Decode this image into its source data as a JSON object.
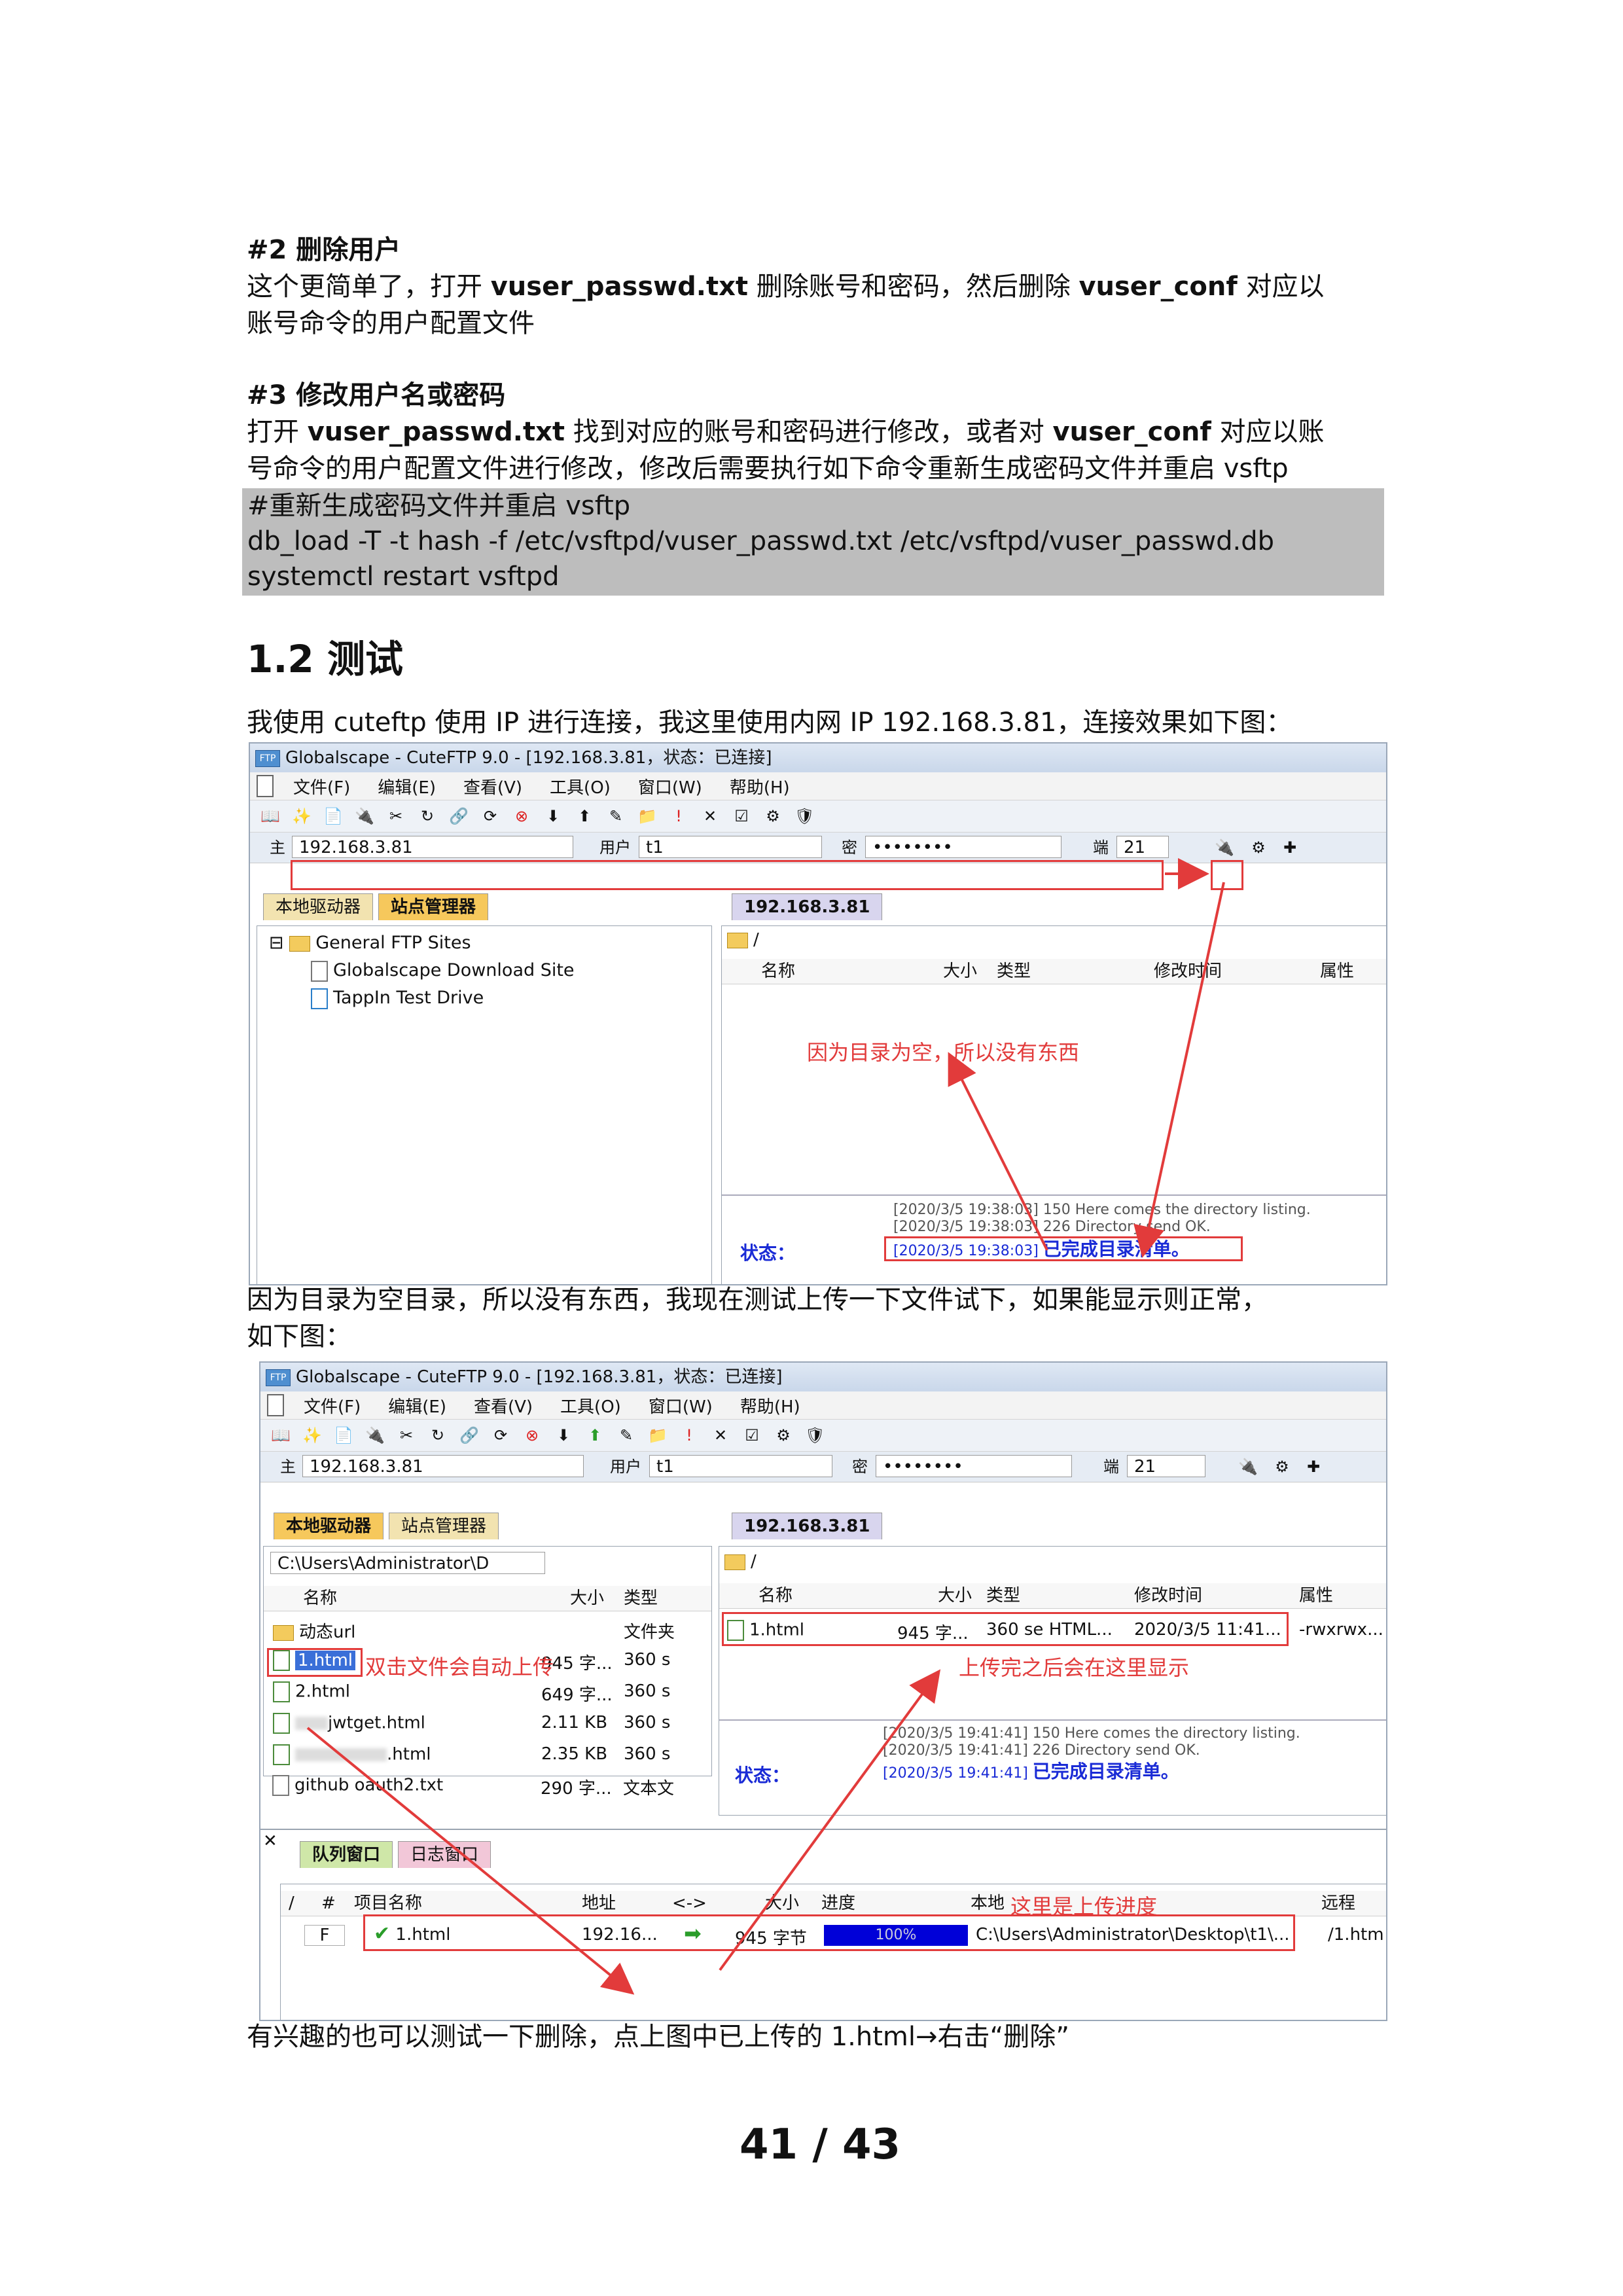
{
  "doc": {
    "sec2_heading": "#2 删除用户",
    "sec2_line1_a": "这个更简单了，打开 ",
    "sec2_line1_b": "vuser_passwd.txt",
    "sec2_line1_c": " 删除账号和密码，然后删除 ",
    "sec2_line1_d": "vuser_conf",
    "sec2_line1_e": " 对应以",
    "sec2_line2": "账号命令的用户配置文件",
    "sec3_heading": "#3 修改用户名或密码",
    "sec3_line1_a": "打开 ",
    "sec3_line1_b": "vuser_passwd.txt",
    "sec3_line1_c": " 找到对应的账号和密码进行修改，或者对 ",
    "sec3_line1_d": "vuser_conf",
    "sec3_line1_e": " 对应以账",
    "sec3_line2": "号命令的用户配置文件进行修改，修改后需要执行如下命令重新生成密码文件并重启 vsftp",
    "code": [
      "#重新生成密码文件并重启 vsftp",
      "db_load -T -t hash -f /etc/vsftpd/vuser_passwd.txt /etc/vsftpd/vuser_passwd.db",
      "systemctl restart vsftpd"
    ],
    "section_title": "1.2 测试",
    "intro": "我使用 cuteftp 使用 IP 进行连接，我这里使用内网 IP 192.168.3.81，连接效果如下图：",
    "mid_line1": "因为目录为空目录，所以没有东西，我现在测试上传一下文件试下，如果能显示则正常，",
    "mid_line2": "如下图：",
    "bottom_line_a": "有兴趣的也可以测试一下删除，点上图中已上传的 ",
    "bottom_line_b": "1.html",
    "bottom_line_c": "→右击“删除”",
    "page_number": "41 / 43"
  },
  "app": {
    "title": "Globalscape - CuteFTP 9.0 - [192.168.3.81，状态：已连接]",
    "icon_text": "FTP",
    "menus": [
      "文件(F)",
      "编辑(E)",
      "查看(V)",
      "工具(O)",
      "窗口(W)",
      "帮助(H)"
    ],
    "host_label": "主",
    "host": "192.168.3.81",
    "user_label": "用户",
    "user": "t1",
    "pass_label": "密",
    "pass": "••••••••",
    "port_label": "端",
    "port": "21",
    "tab_local": "本地驱动器",
    "tab_site": "站点管理器",
    "tab_remote": "192.168.3.81",
    "remote_path": "/",
    "cols": {
      "name": "名称",
      "size": "大小",
      "type": "类型",
      "mtime": "修改时间",
      "attr": "属性"
    }
  },
  "shot1": {
    "tree": [
      "General FTP Sites",
      "Globalscape Download Site",
      "TappIn Test Drive"
    ],
    "note": "因为目录为空，所以没有东西",
    "log1": "[2020/3/5 19:38:03] 150 Here comes the directory listing.",
    "log2": "[2020/3/5 19:38:03] 226 Directory send OK.",
    "status_label": "状态：",
    "status_time": "[2020/3/5 19:38:03]",
    "status_msg": "已完成目录清单。"
  },
  "shot2": {
    "local_path": "C:\\Users\\Administrator\\D",
    "local_files": [
      {
        "name": "动态url",
        "size": "",
        "type": "文件夹"
      },
      {
        "name": "1.html",
        "size": "945 字...",
        "type": "360 s"
      },
      {
        "name": "2.html",
        "size": "649 字...",
        "type": "360 s"
      },
      {
        "name": "jwtget.html",
        "size": "2.11 KB",
        "type": "360 s"
      },
      {
        "name": ".html",
        "size": "2.35 KB",
        "type": "360 s"
      },
      {
        "name": "github oauth2.txt",
        "size": "290 字...",
        "type": "文本文"
      }
    ],
    "note_dblclick": "双击文件会自动上传",
    "remote_file": {
      "name": "1.html",
      "size": "945 字...",
      "type": "360 se HTML...",
      "mtime": "2020/3/5 11:41...",
      "attr": "-rwxrwx..."
    },
    "note_uploaded": "上传完之后会在这里显示",
    "log1": "[2020/3/5 19:41:41] 150 Here comes the directory listing.",
    "log2": "[2020/3/5 19:41:41] 226 Directory send OK.",
    "status_label": "状态：",
    "status_time": "[2020/3/5 19:41:41]",
    "status_msg": "已完成目录清单。",
    "tab_queue": "队列窗口",
    "tab_log": "日志窗口",
    "queue_cols": {
      "num": "#",
      "item": "项目名称",
      "addr": "地址",
      "dir": "<->",
      "size": "大小",
      "progress": "进度",
      "local": "本地",
      "remote": "远程"
    },
    "queue_row": {
      "flag": "F",
      "item": "1.html",
      "addr": "192.16...",
      "size": "945 字节",
      "progress": "100%",
      "local": "C:\\Users\\Administrator\\Desktop\\t1\\...",
      "remote": "/1.htm"
    },
    "note_progress": "这里是上传进度"
  },
  "colors": {
    "annotation_red": "#e23b3b",
    "status_blue": "#1a2bd6",
    "progress_blue": "#0000d8"
  }
}
